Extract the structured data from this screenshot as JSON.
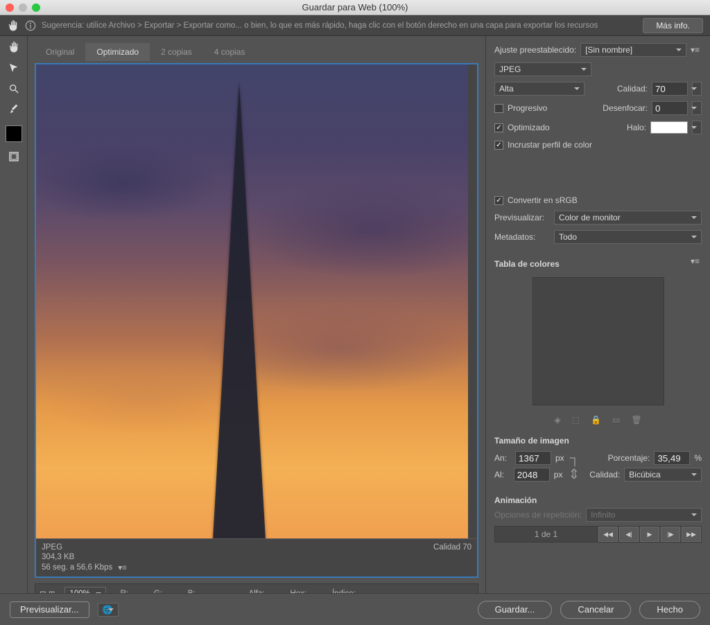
{
  "window": {
    "title": "Guardar para Web (100%)"
  },
  "tip": {
    "text": "Sugerencia: utilice Archivo > Exportar > Exportar como... o bien, lo que es más rápido, haga clic con el botón derecho en una capa para exportar los recursos",
    "more_info": "Más info."
  },
  "tabs": {
    "original": "Original",
    "optimized": "Optimizado",
    "two_up": "2 copias",
    "four_up": "4 copias"
  },
  "preview_info": {
    "format": "JPEG",
    "size": "304,3 KB",
    "time": "56 seg. a 56,6 Kbps",
    "quality_label": "Calidad 70"
  },
  "status": {
    "zoom": "100%",
    "r": "R: --",
    "g": "G: --",
    "b": "B: --",
    "alpha": "Alfa: --",
    "hex": "Hex: --",
    "index": "Índice: --"
  },
  "panel": {
    "preset_label": "Ajuste preestablecido:",
    "preset_value": "[Sin nombre]",
    "format": "JPEG",
    "quality_preset": "Alta",
    "quality_label": "Calidad:",
    "quality_value": "70",
    "progressive": "Progresivo",
    "blur_label": "Desenfocar:",
    "blur_value": "0",
    "optimized": "Optimizado",
    "matte_label": "Halo:",
    "embed_profile": "Incrustar perfil de color",
    "convert_srgb": "Convertir en sRGB",
    "preview_label": "Previsualizar:",
    "preview_value": "Color de monitor",
    "metadata_label": "Metadatos:",
    "metadata_value": "Todo",
    "color_table": "Tabla de colores",
    "image_size": "Tamaño de imagen",
    "w_label": "An:",
    "w_value": "1367",
    "px": "px",
    "h_label": "Al:",
    "h_value": "2048",
    "percent_label": "Porcentaje:",
    "percent_value": "35,49",
    "percent_unit": "%",
    "resample_label": "Calidad:",
    "resample_value": "Bicúbica",
    "animation": "Animación",
    "loop_label": "Opciones de repetición:",
    "loop_value": "Infinito",
    "frame": "1 de 1"
  },
  "footer": {
    "preview": "Previsualizar...",
    "save": "Guardar...",
    "cancel": "Cancelar",
    "done": "Hecho"
  }
}
